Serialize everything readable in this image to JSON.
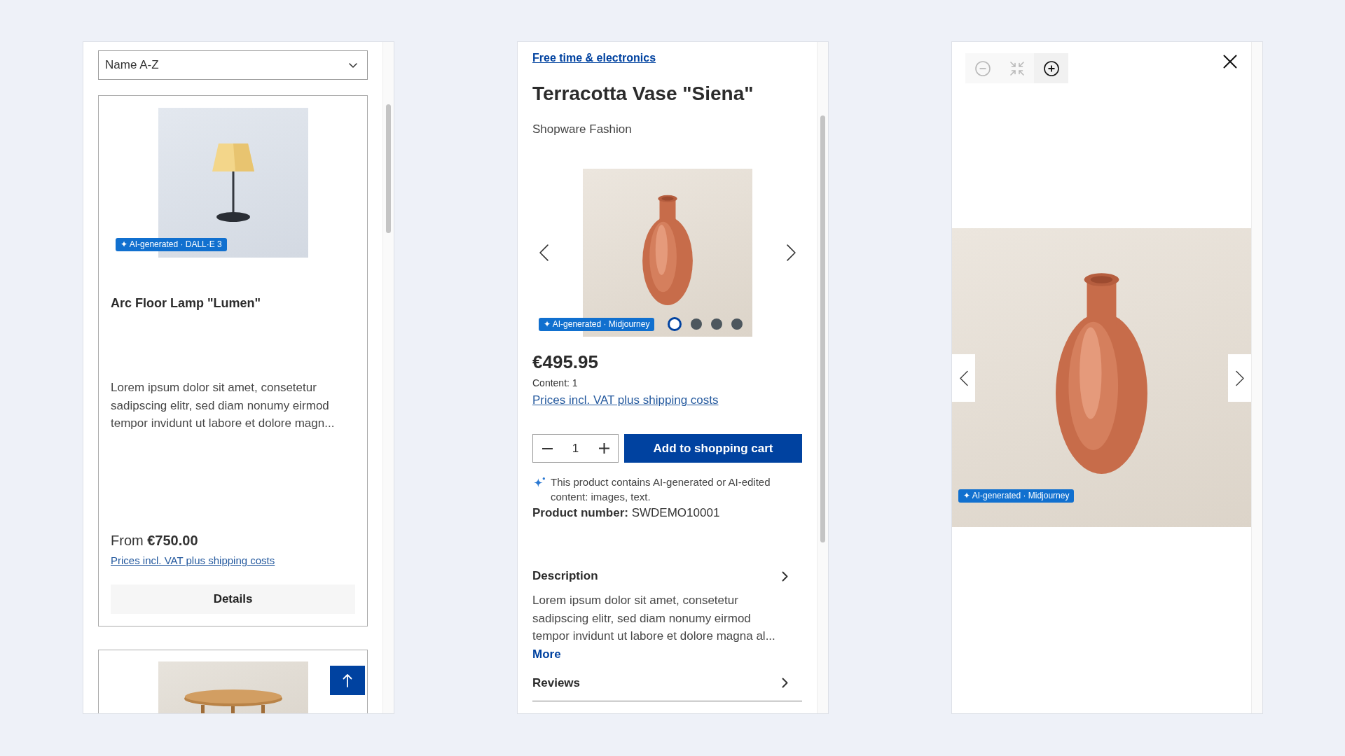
{
  "listing": {
    "sort": {
      "value": "Name A-Z"
    },
    "products": [
      {
        "kind": "lamp",
        "ai_badge": "✦ AI-generated · DALL·E 3",
        "name": "Arc Floor Lamp \"Lumen\"",
        "description": "Lorem ipsum dolor sit amet, consetetur sadipscing elitr, sed diam nonumy eirmod tempor invidunt ut labore et dolore magn...",
        "price": "From **€750.00**",
        "tax_link": "Prices incl. VAT plus shipping costs",
        "button": "Details"
      },
      {
        "kind": "table"
      }
    ]
  },
  "product_detail": {
    "breadcrumb": "Free time & electronics",
    "title": "Terracotta Vase \"Siena\"",
    "manufacturer": "Shopware Fashion",
    "gallery": {
      "ai_badge": "✦ AI-generated · Midjourney",
      "dots": [
        {
          "selected": true
        },
        {
          "selected": false
        },
        {
          "selected": false
        },
        {
          "selected": false
        }
      ]
    },
    "price": "€495.95",
    "content": "Content: 1",
    "tax_link": "Prices incl. VAT plus shipping costs",
    "quantity": {
      "value": "1"
    },
    "buy_button": "Add to shopping cart",
    "ai_notice": "This product contains AI-generated or AI-edited content: images, text.",
    "product_number": "**Product number:** SWDEMO10001",
    "sections": [
      {
        "title": "Description",
        "text": "Lorem ipsum dolor sit amet, consetetur sadipscing elitr, sed diam nonumy eirmod tempor invidunt ut labore et dolore magna al...",
        "more_link": "More"
      },
      {
        "title": "Reviews"
      }
    ]
  },
  "zoom_modal": {
    "controls": [
      {
        "kind": "minus",
        "disabled": true
      },
      {
        "kind": "shrink",
        "disabled": true
      },
      {
        "kind": "plus",
        "disabled": false
      }
    ],
    "image": {
      "ai_badge": "✦ AI-generated · Midjourney"
    }
  }
}
